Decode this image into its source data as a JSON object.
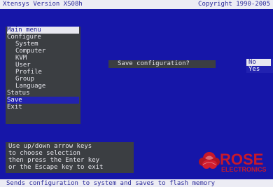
{
  "header": {
    "version": "Xtensys Version XS08h",
    "copyright": "Copyright 1990-2005"
  },
  "menu": {
    "title": "Main menu",
    "items": [
      {
        "label": "Configure",
        "indent": 0
      },
      {
        "label": "System",
        "indent": 1
      },
      {
        "label": "Computer",
        "indent": 1
      },
      {
        "label": "KVM",
        "indent": 1
      },
      {
        "label": "User",
        "indent": 1
      },
      {
        "label": "Profile",
        "indent": 1
      },
      {
        "label": "Group",
        "indent": 1
      },
      {
        "label": "Language",
        "indent": 1
      },
      {
        "label": "Status",
        "indent": 0
      },
      {
        "label": "Save",
        "indent": 0,
        "selected": true
      },
      {
        "label": "Exit",
        "indent": 0
      }
    ]
  },
  "dialog": {
    "question": "Save configuration?",
    "options": [
      {
        "label": "No",
        "selected": true
      },
      {
        "label": "Yes",
        "selected": false
      }
    ]
  },
  "help": {
    "lines": [
      "Use up/down arrow keys",
      "to choose selection",
      "then press the Enter key",
      "or the Escape key to exit"
    ]
  },
  "logo": {
    "name": "ROSE",
    "sub": "ELECTRONICS"
  },
  "status_bar": "Sends configuration to system and saves to flash memory",
  "colors": {
    "background": "#1616a8",
    "panel": "#3b3e42",
    "highlight": "#2222b0",
    "bar": "#ececf4",
    "logo_red": "#c8182a"
  }
}
